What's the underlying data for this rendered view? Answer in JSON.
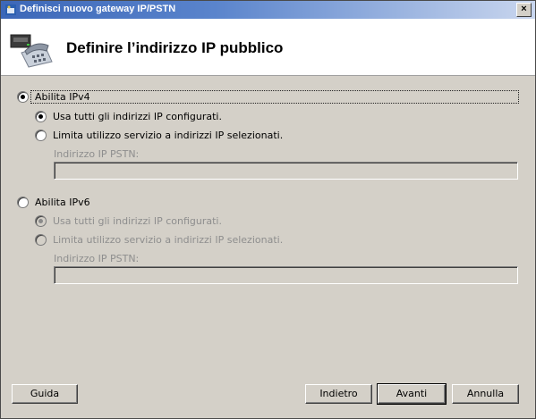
{
  "window": {
    "title": "Definisci nuovo gateway IP/PSTN",
    "close_glyph": "×"
  },
  "header": {
    "title": "Definire l’indirizzo IP pubblico",
    "icon": "gateway-phone-icon"
  },
  "ipv4": {
    "label": "Abilita IPv4",
    "checked": true,
    "option_all": "Usa tutti gli indirizzi IP configurati.",
    "option_all_checked": true,
    "option_limit": "Limita utilizzo servizio a indirizzi IP selezionati.",
    "option_limit_checked": false,
    "field_label": "Indirizzo IP PSTN:",
    "field_value": ""
  },
  "ipv6": {
    "label": "Abilita IPv6",
    "checked": false,
    "option_all": "Usa tutti gli indirizzi IP configurati.",
    "option_all_checked": true,
    "option_limit": "Limita utilizzo servizio a indirizzi IP selezionati.",
    "option_limit_checked": false,
    "field_label": "Indirizzo IP PSTN:",
    "field_value": ""
  },
  "buttons": {
    "help": "Guida",
    "back": "Indietro",
    "next": "Avanti",
    "cancel": "Annulla"
  }
}
